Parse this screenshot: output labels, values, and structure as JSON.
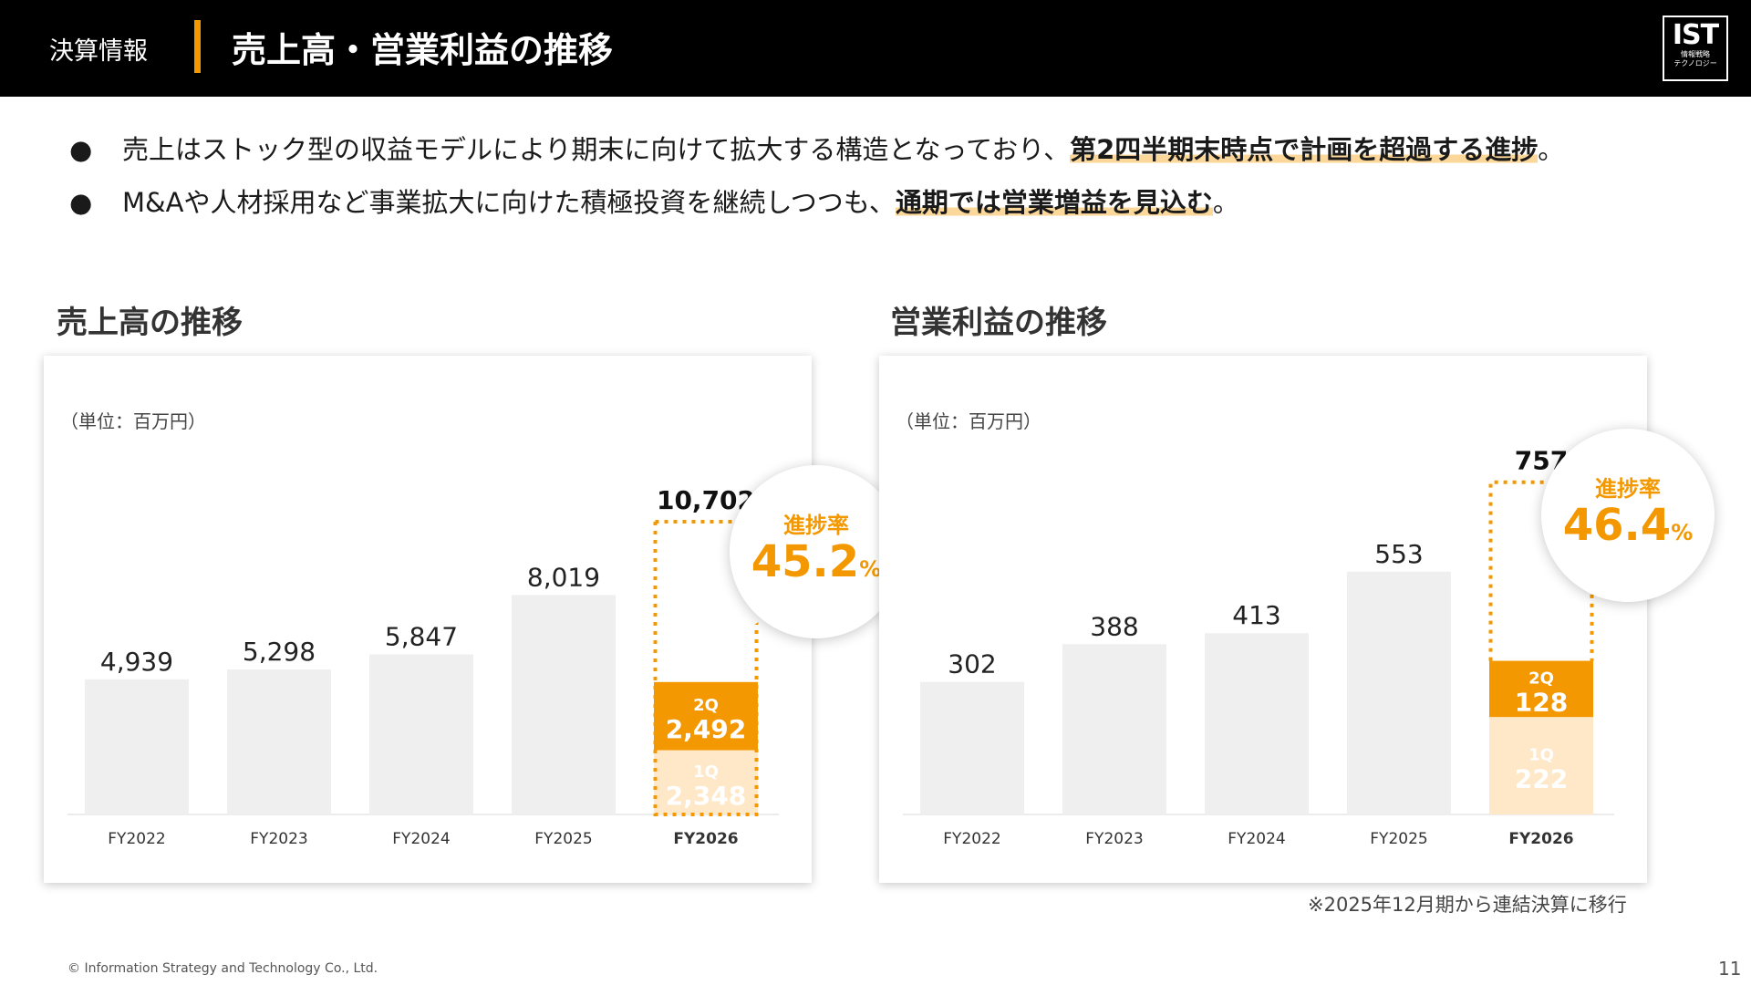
{
  "header": {
    "category": "決算情報",
    "title": "売上高・営業利益の推移",
    "logo_main": "IST",
    "logo_sub1": "情報戦略",
    "logo_sub2": "テクノロジー"
  },
  "bullets": [
    {
      "text": "売上はストック型の収益モデルにより期末に向けて拡大する構造となっており、",
      "highlight": "第2四半期末時点で計画を超過する進捗",
      "end": "。"
    },
    {
      "text": "M&Aや人材採用など事業拡大に向けた積極投資を継続しつつも、",
      "highlight": "通期では営業増益を見込む",
      "end": "。"
    }
  ],
  "bullet_marker": "●",
  "colors": {
    "accent": "#f39800",
    "light_accent": "#ffe8c8",
    "bar_gray": "#efefef"
  },
  "chart_data": [
    {
      "type": "bar",
      "title": "売上高の推移",
      "unit_label": "（単位：百万円）",
      "categories": [
        "FY2022",
        "FY2023",
        "FY2024",
        "FY2025",
        "FY2026"
      ],
      "values": [
        4939,
        5298,
        5847,
        8019,
        null
      ],
      "value_labels": [
        "4,939",
        "5,298",
        "5,847",
        "8,019",
        "10,702"
      ],
      "forecast": {
        "category": "FY2026",
        "total": 10702,
        "total_label": "10,702",
        "q1": 2348,
        "q1_label": "2,348",
        "q1_name": "1Q",
        "q2": 2492,
        "q2_label": "2,492",
        "q2_name": "2Q"
      },
      "progress_label": "進捗率",
      "progress_value": "45.2",
      "progress_unit": "%",
      "ylim": [
        0,
        12000
      ]
    },
    {
      "type": "bar",
      "title": "営業利益の推移",
      "unit_label": "（単位：百万円）",
      "categories": [
        "FY2022",
        "FY2023",
        "FY2024",
        "FY2025",
        "FY2026"
      ],
      "values": [
        302,
        388,
        413,
        553,
        null
      ],
      "value_labels": [
        "302",
        "388",
        "413",
        "553",
        "757"
      ],
      "forecast": {
        "category": "FY2026",
        "total": 757,
        "total_label": "757",
        "q1": 222,
        "q1_label": "222",
        "q1_name": "1Q",
        "q2": 128,
        "q2_label": "128",
        "q2_name": "2Q"
      },
      "progress_label": "進捗率",
      "progress_value": "46.4",
      "progress_unit": "%",
      "ylim": [
        0,
        800
      ]
    }
  ],
  "note": "※2025年12月期から連結決算に移行",
  "copyright": "© Information Strategy and Technology Co., Ltd.",
  "page_number": "11"
}
